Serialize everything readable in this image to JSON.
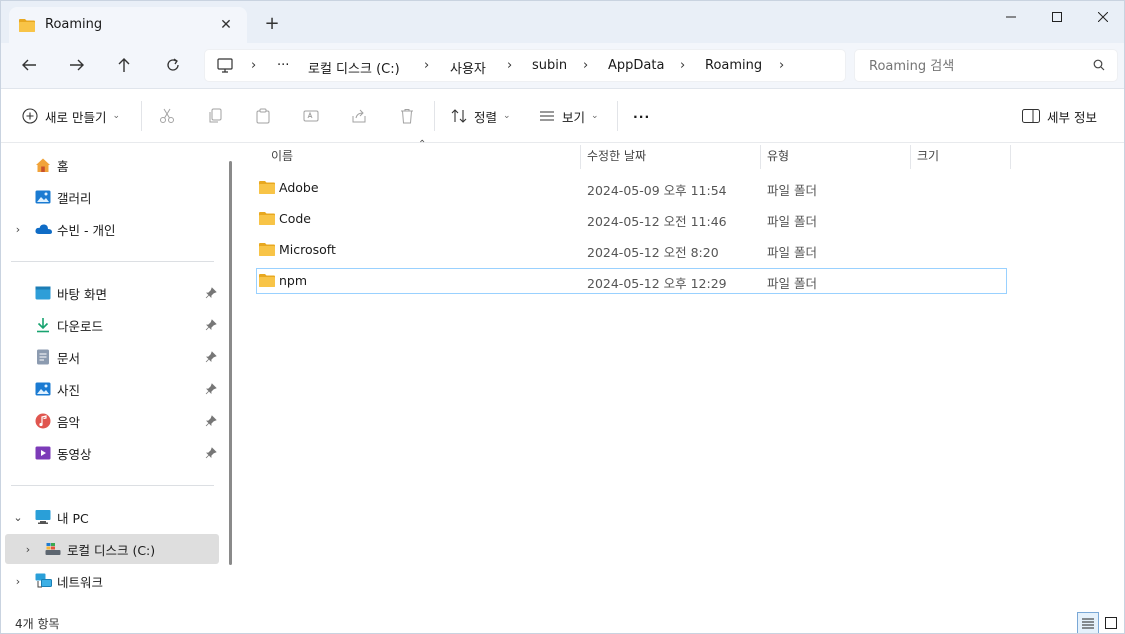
{
  "titlebar": {
    "tab_title": "Roaming",
    "new_tab": "+",
    "close_tab": "✕"
  },
  "address": {
    "overflow": "···",
    "crumbs": [
      "로컬 디스크 (C:)",
      "사용자",
      "subin",
      "AppData",
      "Roaming"
    ],
    "sep": "›"
  },
  "search": {
    "placeholder": "Roaming 검색"
  },
  "commands": {
    "new": "새로 만들기",
    "sort": "정렬",
    "view": "보기",
    "more": "···",
    "details": "세부 정보"
  },
  "sidebar": {
    "home": "홈",
    "gallery": "갤러리",
    "onedrive": "수빈 - 개인",
    "desktop": "바탕 화면",
    "downloads": "다운로드",
    "documents": "문서",
    "pictures": "사진",
    "music": "음악",
    "videos": "동영상",
    "this_pc": "내 PC",
    "local_disk": "로컬 디스크 (C:)",
    "network": "네트워크"
  },
  "columns": {
    "name": "이름",
    "modified": "수정한 날짜",
    "type": "유형",
    "size": "크기"
  },
  "files": [
    {
      "name": "Adobe",
      "date": "2024-05-09 오후 11:54",
      "type": "파일 폴더"
    },
    {
      "name": "Code",
      "date": "2024-05-12 오전 11:46",
      "type": "파일 폴더"
    },
    {
      "name": "Microsoft",
      "date": "2024-05-12 오전 8:20",
      "type": "파일 폴더"
    },
    {
      "name": "npm",
      "date": "2024-05-12 오후 12:29",
      "type": "파일 폴더"
    }
  ],
  "status": {
    "count": "4개 항목"
  },
  "colors": {
    "folder": "#f8c447",
    "folder_dark": "#e8a820",
    "selection_border": "#99d1ff",
    "accent": "#0067c0"
  }
}
